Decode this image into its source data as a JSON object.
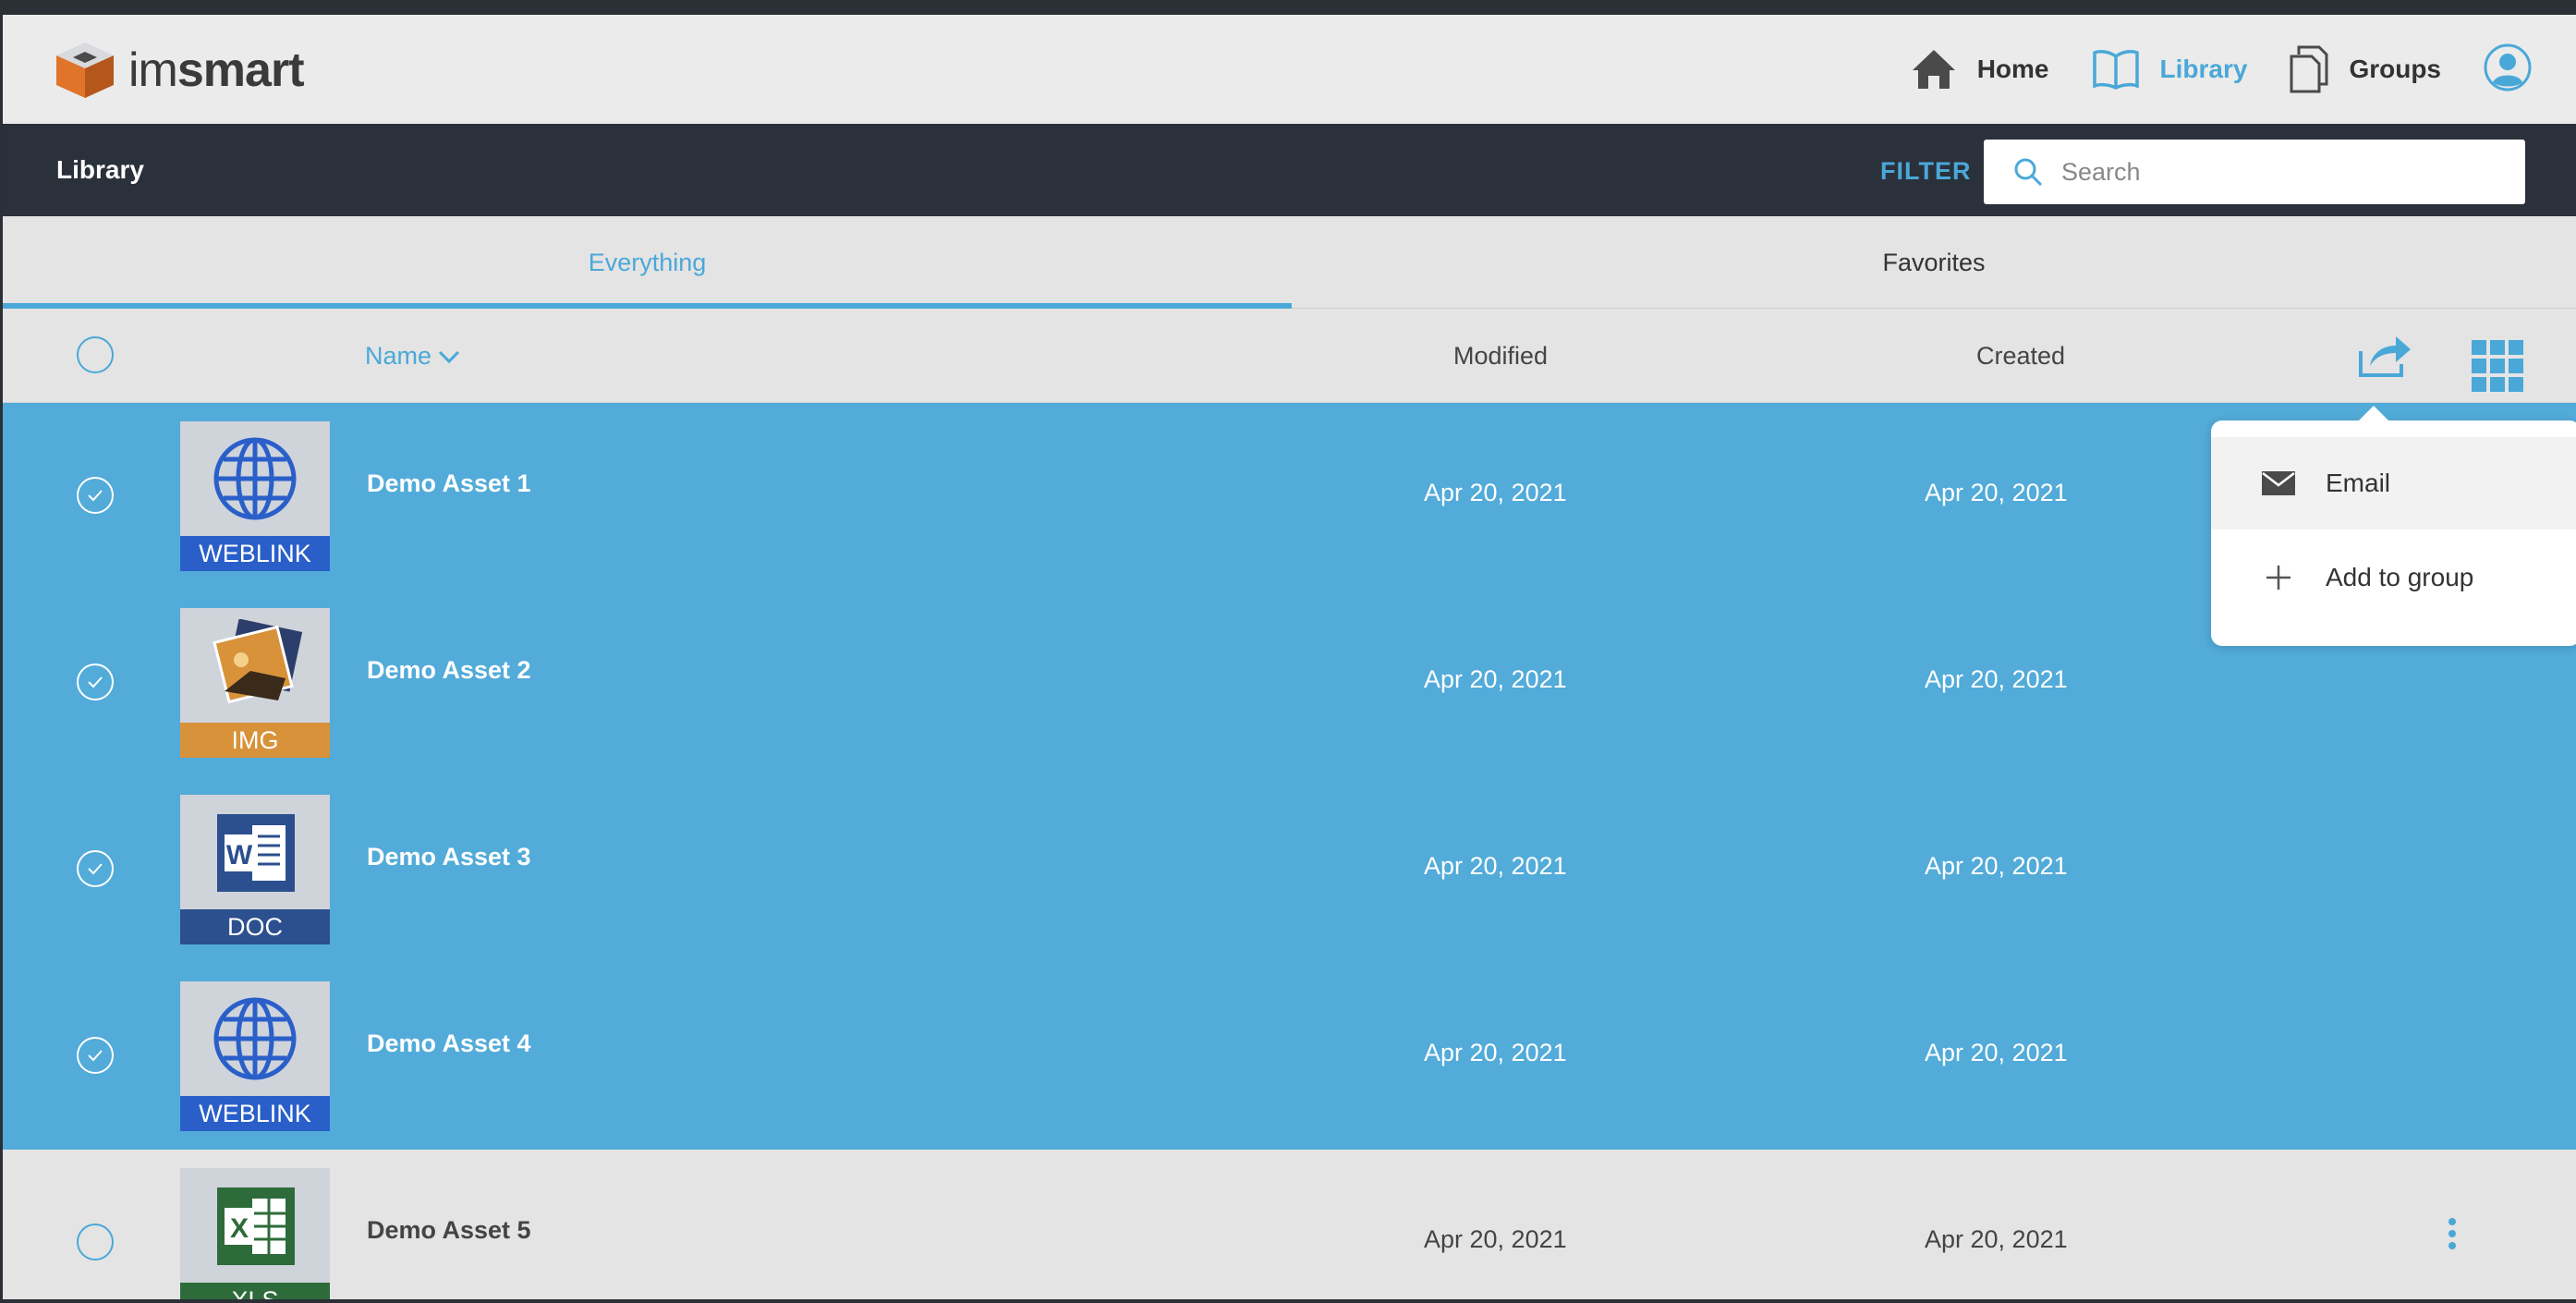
{
  "brand": {
    "name_light": "im",
    "name_bold": "smart"
  },
  "nav": [
    {
      "label": "Home",
      "icon": "home-icon"
    },
    {
      "label": "Library",
      "icon": "book-icon",
      "active": true
    },
    {
      "label": "Groups",
      "icon": "documents-icon"
    }
  ],
  "library_bar": {
    "title": "Library",
    "filter_label": "FILTER",
    "search_placeholder": "Search"
  },
  "tabs": [
    {
      "label": "Everything",
      "active": true
    },
    {
      "label": "Favorites",
      "active": false
    }
  ],
  "columns": {
    "name": "Name",
    "modified": "Modified",
    "created": "Created"
  },
  "rows": [
    {
      "name": "Demo Asset 1",
      "type": "WEBLINK",
      "modified": "Apr 20, 2021",
      "created": "Apr 20, 2021",
      "selected": true
    },
    {
      "name": "Demo Asset 2",
      "type": "IMG",
      "modified": "Apr 20, 2021",
      "created": "Apr 20, 2021",
      "selected": true
    },
    {
      "name": "Demo Asset 3",
      "type": "DOC",
      "modified": "Apr 20, 2021",
      "created": "Apr 20, 2021",
      "selected": true
    },
    {
      "name": "Demo Asset 4",
      "type": "WEBLINK",
      "modified": "Apr 20, 2021",
      "created": "Apr 20, 2021",
      "selected": true
    },
    {
      "name": "Demo Asset 5",
      "type": "XLS",
      "modified": "Apr 20, 2021",
      "created": "Apr 20, 2021",
      "selected": false
    }
  ],
  "share_menu": {
    "items": [
      {
        "label": "Email",
        "icon": "mail-icon"
      },
      {
        "label": "Add to group",
        "icon": "plus-icon"
      }
    ]
  },
  "colors": {
    "accent": "#4aa8d8",
    "selected_row": "#52abd9",
    "dark_bar": "#2b313b",
    "weblink": "#2a5fc9",
    "img": "#d7923a",
    "doc": "#2c4f8f",
    "xls": "#2e6b3a"
  }
}
